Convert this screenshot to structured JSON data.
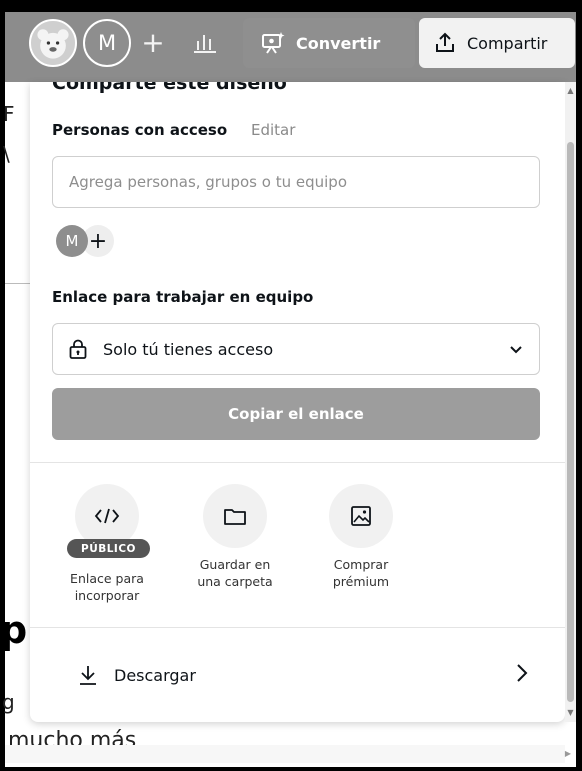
{
  "toolbar": {
    "avatar_initial": "M",
    "add_label": "+",
    "convert_label": "Convertir",
    "share_label": "Compartir"
  },
  "background": {
    "fragment_f": "F",
    "fragment_slash": "\\",
    "fragment_p": "p",
    "fragment_g": "g",
    "fragment_mucho": "mucho más"
  },
  "share_panel": {
    "heading": "Comparte este diseño",
    "people_label": "Personas con acceso",
    "edit_label": "Editar",
    "people_input_placeholder": "Agrega personas, grupos o tu equipo",
    "member_initial": "M",
    "add_member_label": "+",
    "link_label": "Enlace para trabajar en equipo",
    "access_value": "Solo tú tienes acceso",
    "copy_button_label": "Copiar el enlace",
    "options": [
      {
        "label_line1": "Enlace para",
        "label_line2": "incorporar",
        "badge": "PÚBLICO",
        "icon": "code-icon"
      },
      {
        "label_line1": "Guardar en",
        "label_line2": "una carpeta",
        "icon": "folder-icon"
      },
      {
        "label_line1": "Comprar",
        "label_line2": "prémium",
        "icon": "image-icon"
      }
    ],
    "download_label": "Descargar"
  },
  "colors": {
    "toolbar_bg": "#8c8c8c",
    "copy_button_bg": "#9d9d9d",
    "badge_bg": "#555555",
    "text": "#0e1318",
    "muted": "#8a8a8a"
  }
}
